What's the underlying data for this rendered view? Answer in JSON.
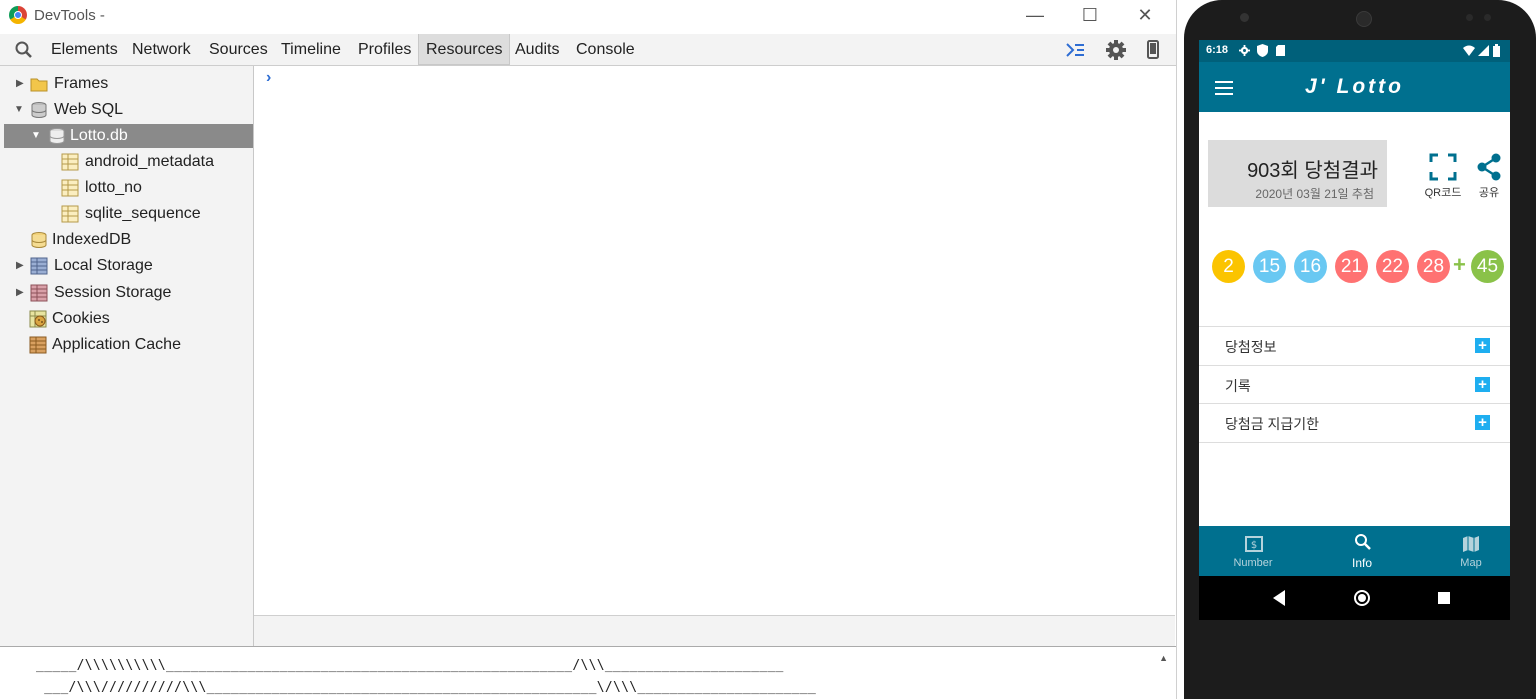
{
  "window": {
    "title": "DevTools -",
    "minimize": "—",
    "maximize": "☐",
    "close": "✕"
  },
  "toolbar": {
    "tabs": [
      "Elements",
      "Network",
      "Sources",
      "Timeline",
      "Profiles",
      "Resources",
      "Audits",
      "Console"
    ],
    "active_tab": "Resources"
  },
  "sidebar": {
    "items": [
      {
        "label": "Frames",
        "icon": "folder-icon",
        "expanded": false
      },
      {
        "label": "Web SQL",
        "icon": "database-icon",
        "expanded": true
      },
      {
        "label": "Lotto.db",
        "icon": "database-icon",
        "expanded": true,
        "selected": true
      },
      {
        "label": "android_metadata",
        "icon": "table-icon"
      },
      {
        "label": "lotto_no",
        "icon": "table-icon"
      },
      {
        "label": "sqlite_sequence",
        "icon": "table-icon"
      },
      {
        "label": "IndexedDB",
        "icon": "database-icon"
      },
      {
        "label": "Local Storage",
        "icon": "storage-grid-icon",
        "expanded": false
      },
      {
        "label": "Session Storage",
        "icon": "storage-grid-icon",
        "expanded": false
      },
      {
        "label": "Cookies",
        "icon": "cookie-icon"
      },
      {
        "label": "Application Cache",
        "icon": "cache-grid-icon"
      }
    ]
  },
  "main": {
    "prompt": "›"
  },
  "console": {
    "lines": [
      "_____/\\\\\\\\\\\\\\\\\\\\__________________________________________________/\\\\\\______________________",
      " ___/\\\\\\//////////\\\\\\________________________________________________\\/\\\\\\______________________"
    ]
  },
  "phone": {
    "status": {
      "time": "6:18"
    },
    "app_title": "J' Lotto",
    "round_title": "903회 당첨결과",
    "draw_date": "2020년 03월 21일 추첨",
    "qr_label": "QR코드",
    "share_label": "공유",
    "balls": [
      "2",
      "15",
      "16",
      "21",
      "22",
      "28"
    ],
    "bonus_plus": "+",
    "bonus": "45",
    "colors": {
      "yellow": "#fbc400",
      "blue": "#69c8f2",
      "red": "#ff7272",
      "green": "#8ac249",
      "bar": "#00708f",
      "status": "#00607a"
    },
    "accordion": [
      "당첨정보",
      "기록",
      "당첨금 지급기한"
    ],
    "nav": [
      "Number",
      "Info",
      "Map"
    ],
    "active_nav": "Info"
  }
}
